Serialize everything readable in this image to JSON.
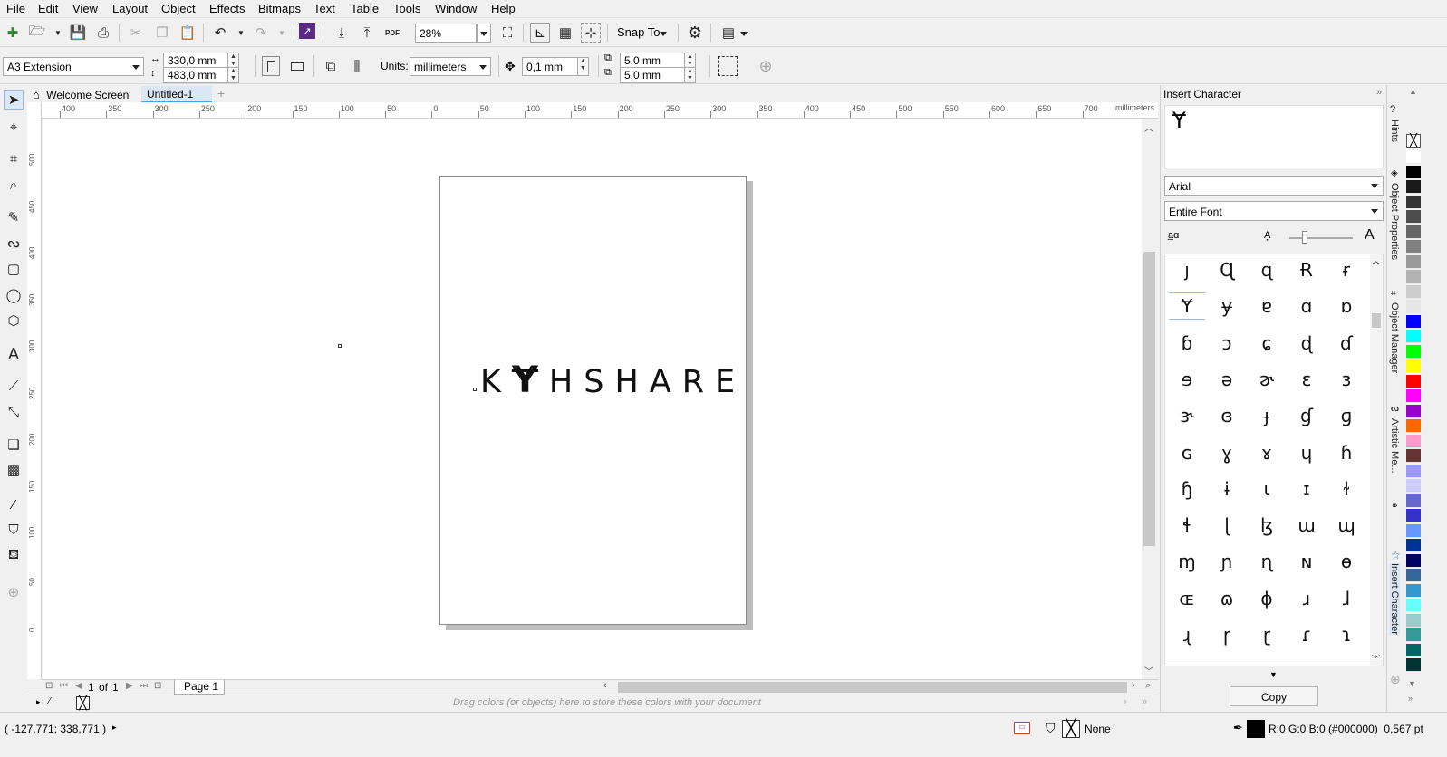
{
  "menu": [
    "File",
    "Edit",
    "View",
    "Layout",
    "Object",
    "Effects",
    "Bitmaps",
    "Text",
    "Table",
    "Tools",
    "Window",
    "Help"
  ],
  "standard_toolbar": {
    "zoom_value": "28%",
    "snap_label": "Snap To",
    "pdf_label": "PDF",
    "icons": [
      "new-document-icon",
      "open-icon",
      "save-icon",
      "print-icon",
      "cut-icon",
      "copy-icon",
      "paste-icon",
      "undo-icon",
      "redo-icon",
      "corel-connect-icon",
      "import-icon",
      "export-icon",
      "publish-pdf-icon",
      "full-screen-preview-icon",
      "show-rulers-icon",
      "show-grid-icon",
      "show-guidelines-icon",
      "options-icon",
      "application-launcher-icon"
    ]
  },
  "property_bar": {
    "page_size": "A3 Extension",
    "width": "330,0 mm",
    "height": "483,0 mm",
    "units_label": "Units:",
    "units_value": "millimeters",
    "nudge": "0,1 mm",
    "dup_x": "5,0 mm",
    "dup_y": "5,0 mm"
  },
  "tabs": {
    "welcome": "Welcome Screen",
    "document": "Untitled-1"
  },
  "toolbox_icons": [
    "pick-tool-icon",
    "shape-tool-icon",
    "crop-tool-icon",
    "zoom-tool-icon",
    "freehand-tool-icon",
    "artistic-media-icon",
    "rectangle-tool-icon",
    "ellipse-tool-icon",
    "polygon-tool-icon",
    "text-tool-icon",
    "parallel-dimension-icon",
    "connector-tool-icon",
    "drop-shadow-tool-icon",
    "transparency-tool-icon",
    "eyedropper-tool-icon",
    "interactive-fill-icon",
    "smart-fill-icon",
    "add-tool-icon"
  ],
  "ruler": {
    "unit_label": "millimeters",
    "h_ticks": [
      "400",
      "350",
      "300",
      "250",
      "200",
      "150",
      "100",
      "50",
      "0",
      "50",
      "100",
      "150",
      "200",
      "250",
      "300",
      "350",
      "400",
      "450",
      "500",
      "550",
      "600",
      "650",
      "700"
    ],
    "v_ticks": [
      "500",
      "450",
      "400",
      "350",
      "300",
      "250",
      "200",
      "150",
      "100",
      "50",
      "0"
    ]
  },
  "canvas": {
    "artwork_text_left": "K",
    "artwork_glyph": "Ɏ",
    "artwork_text_right": "HSHARE"
  },
  "page_nav": {
    "current": "1",
    "of_label": "of",
    "total": "1",
    "page_tab": "Page 1"
  },
  "color_tray": {
    "hint": "Drag colors (or objects) here to store these colors with your document"
  },
  "status": {
    "coords": "( -127,771; 338,771 )",
    "fill_label": "None",
    "outline_info": "R:0 G:0 B:0 (#000000)  0,567 pt"
  },
  "docker": {
    "title": "Insert Character",
    "preview_glyph": "Ɏ",
    "font": "Arial",
    "subset": "Entire Font",
    "copy_button": "Copy",
    "glyphs": [
      [
        "ȷ",
        "Ɋ",
        "ɋ",
        "Ɍ",
        "ɍ"
      ],
      [
        "Ɏ",
        "ɏ",
        "ɐ",
        "ɑ",
        "ɒ"
      ],
      [
        "ɓ",
        "ɔ",
        "ɕ",
        "ɖ",
        "ɗ"
      ],
      [
        "ɘ",
        "ə",
        "ɚ",
        "ɛ",
        "ɜ"
      ],
      [
        "ɝ",
        "ɞ",
        "ɟ",
        "ɠ",
        "ɡ"
      ],
      [
        "ɢ",
        "ɣ",
        "ɤ",
        "ɥ",
        "ɦ"
      ],
      [
        "ɧ",
        "ɨ",
        "ɩ",
        "ɪ",
        "ɫ"
      ],
      [
        "ɬ",
        "ɭ",
        "ɮ",
        "ɯ",
        "ɰ"
      ],
      [
        "ɱ",
        "ɲ",
        "ɳ",
        "ɴ",
        "ɵ"
      ],
      [
        "ɶ",
        "ɷ",
        "ɸ",
        "ɹ",
        "ɺ"
      ],
      [
        "ɻ",
        "ɼ",
        "ɽ",
        "ɾ",
        "ɿ"
      ]
    ]
  },
  "side_tabs": [
    "Hints",
    "Object Properties",
    "Object Manager",
    "Artistic Me...",
    "Insert Character"
  ],
  "palette_colors": [
    "#ffffff",
    "#000000",
    "#1a1a1a",
    "#333333",
    "#4d4d4d",
    "#666666",
    "#808080",
    "#999999",
    "#b3b3b3",
    "#cccccc",
    "#e6e6e6",
    "#0000ff",
    "#00ffff",
    "#00ff00",
    "#ffff00",
    "#ff0000",
    "#ff00ff",
    "#9900cc",
    "#ff6600",
    "#ff99cc",
    "#663333",
    "#9999ff",
    "#ccccff",
    "#6666cc",
    "#3333cc",
    "#6699ff",
    "#003399",
    "#000066",
    "#336699",
    "#3399cc",
    "#66ffff",
    "#99cccc",
    "#339999",
    "#006666",
    "#003333"
  ]
}
